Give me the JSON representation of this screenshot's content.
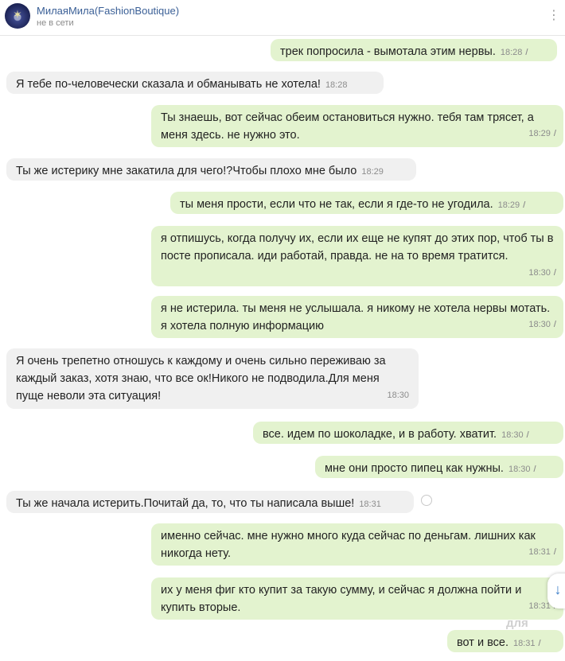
{
  "header": {
    "contact_name": "МилаяМила(FashionBoutique)",
    "status": "не в сети"
  },
  "messages": [
    {
      "side": "out",
      "text": "трек попросила - вымотала этим нервы.",
      "time": "18:28"
    },
    {
      "side": "in",
      "text": "Я тебе по-человечески сказала и обманывать не хотела!",
      "time": "18:28"
    },
    {
      "side": "out",
      "text": "Ты знаешь, вот сейчас обеим остановиться нужно. тебя там трясет, а меня здесь. не нужно это.",
      "time": "18:29"
    },
    {
      "side": "in",
      "text": "Ты же истерику мне закатила для чего!?Чтобы плохо мне было",
      "time": "18:29"
    },
    {
      "side": "out",
      "text": "ты меня прости, если что не так, если я где-то не угодила.",
      "time": "18:29"
    },
    {
      "side": "out",
      "text": "я отпишусь, когда получу их, если их еще не купят до этих пор, чтоб ты в посте прописала. иди работай, правда. не на то время тратится.",
      "time": "18:30"
    },
    {
      "side": "out",
      "text": "я не истерила. ты меня не услышала. я никому не хотела нервы мотать. я хотела полную информацию",
      "time": "18:30"
    },
    {
      "side": "in",
      "text": "Я очень трепетно отношусь к каждому и очень сильно переживаю за каждый заказ, хотя знаю, что все ок!Никого не подводила.Для меня пуще неволи эта ситуация!",
      "time": "18:30"
    },
    {
      "side": "out",
      "text": "все. идем по шоколадке, и в работу. хватит.",
      "time": "18:30"
    },
    {
      "side": "out",
      "text": "мне они просто пипец как нужны.",
      "time": "18:30"
    },
    {
      "side": "in",
      "text": "Ты же начала истерить.Почитай да, то, что ты написала выше!",
      "time": "18:31"
    },
    {
      "side": "out",
      "text": "именно сейчас. мне нужно много куда сейчас по деньгам. лишних как никогда нету.",
      "time": "18:31"
    },
    {
      "side": "out",
      "text": "их у меня фиг кто купит за такую сумму, и сейчас я должна пойти и купить вторые.",
      "time": "18:31"
    },
    {
      "side": "out",
      "text": "вот и все.",
      "time": "18:31"
    }
  ],
  "ticks_glyph": "//",
  "watermark": "для",
  "colors": {
    "outgoing_bubble": "#e3f3cf",
    "incoming_bubble": "#f0f0f0",
    "name_link": "#3a5f96"
  }
}
